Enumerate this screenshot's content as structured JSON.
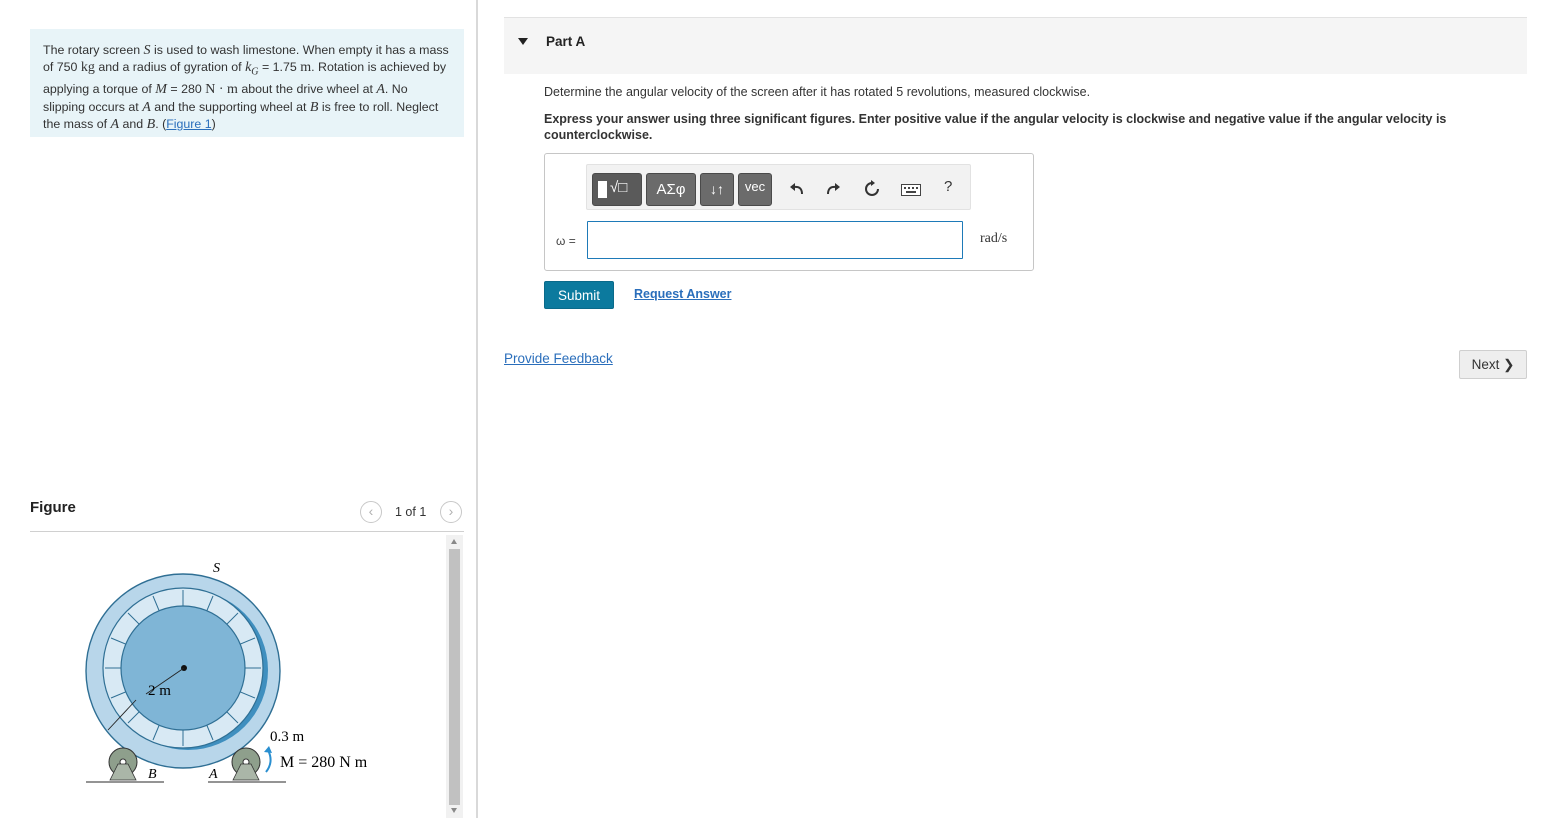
{
  "problem": {
    "t1": "The rotary screen ",
    "sym_S": "S",
    "t2": " is used to wash limestone. When empty it has a mass of 750 ",
    "unit_kg": "kg",
    "t3": " and a radius of gyration of ",
    "sym_k": "k",
    "sym_G": "G",
    "t4": " = 1.75 ",
    "unit_m": "m",
    "t5": ". Rotation is achieved by applying a torque of ",
    "sym_M": "M",
    "t6": " = 280 ",
    "unit_Nm": "N · m",
    "t7": " about the drive wheel at ",
    "sym_A1": "A",
    "t8": ". No slipping occurs at ",
    "sym_A2": "A",
    "t9": " and the supporting wheel at ",
    "sym_B1": "B",
    "t10": " is free to roll. Neglect the mass of ",
    "sym_A3": "A",
    "t11": " and ",
    "sym_B2": "B",
    "t12": ". (",
    "figure_link": "Figure 1",
    "t13": ")"
  },
  "figure": {
    "title": "Figure",
    "pager": "1 of 1",
    "prev_icon": "chevron-left-icon",
    "next_icon": "chevron-right-icon",
    "labels": {
      "S": "S",
      "radius": "2 m",
      "small_radius": "0.3 m",
      "A": "A",
      "B": "B",
      "moment": "M = 280 N  m"
    },
    "colors": {
      "outer": "#b8d6ea",
      "drum": "#7fb5d6",
      "dark": "#3f8fbf",
      "wheel": "#8e9f8c",
      "arrow": "#2a8fd0"
    }
  },
  "part": {
    "title": "Part A",
    "question": "Determine the angular velocity of the screen after it has rotated 5 revolutions, measured clockwise.",
    "instruction": "Express your answer using three significant figures. Enter positive value if the angular velocity is clockwise and negative value if the angular velocity is counterclockwise."
  },
  "toolbar": {
    "templates": "√□",
    "greek": "ΑΣφ",
    "arrows": "↓↑",
    "vec": "vec",
    "help": "?",
    "icons": [
      "undo-icon",
      "redo-icon",
      "reset-icon",
      "keyboard-icon"
    ]
  },
  "answer": {
    "label": "ω =",
    "value": "",
    "unit": "rad/s"
  },
  "actions": {
    "submit": "Submit",
    "request_answer": "Request Answer",
    "provide_feedback": "Provide Feedback",
    "next": "Next ❯"
  }
}
